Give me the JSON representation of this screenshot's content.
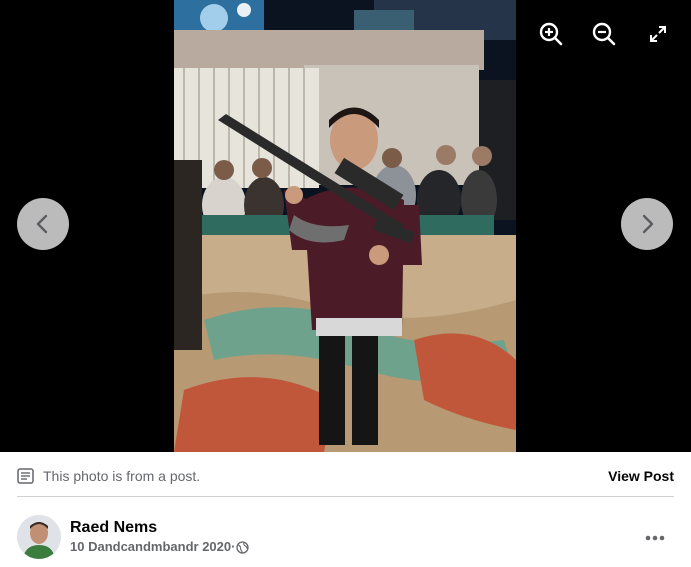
{
  "viewer": {
    "photo_alt": "",
    "controls": {
      "zoom_in_icon": "zoom-in-icon",
      "zoom_out_icon": "zoom-out-icon",
      "fullscreen_icon": "fullscreen-icon",
      "previous_icon": "chevron-left-icon",
      "next_icon": "chevron-right-icon"
    }
  },
  "post_note": {
    "text": "This photo is from a post.",
    "view_post_label": "View Post",
    "icon": "post-icon"
  },
  "author": {
    "name": "Raed Nems",
    "date": "10 Dandcandmbandr 2020",
    "separator": "·",
    "audience_icon": "globe-icon"
  },
  "more_icon": "more-options-icon",
  "colors": {
    "viewer_bg": "#000000",
    "secondary_text": "#65676b",
    "primary_text": "#050505",
    "nav_button": "#dcdcdc"
  }
}
